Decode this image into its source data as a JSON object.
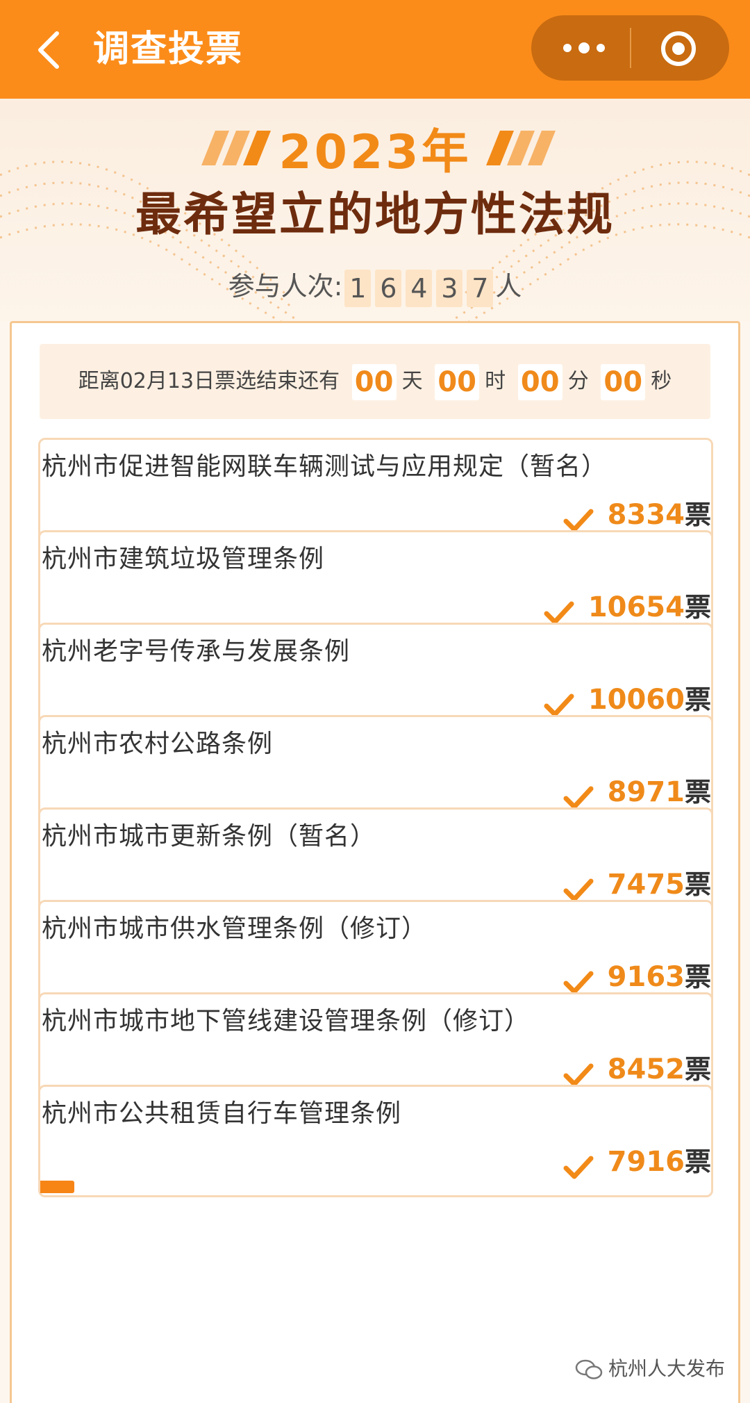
{
  "header": {
    "title": "调查投票"
  },
  "hero": {
    "year": "2023年",
    "headline": "最希望立的地方性法规",
    "participants_label": "参与人次:",
    "participants_digits": [
      "1",
      "6",
      "4",
      "3",
      "7"
    ],
    "participants_unit": "人"
  },
  "countdown": {
    "prefix": "距离02月13日票选结束还有",
    "days": "00",
    "days_unit": "天",
    "hours": "00",
    "hours_unit": "时",
    "minutes": "00",
    "minutes_unit": "分",
    "seconds": "00",
    "seconds_unit": "秒"
  },
  "vote_unit": "票",
  "items": [
    {
      "name": "杭州市促进智能网联车辆测试与应用规定（暂名）",
      "votes": "8334",
      "bar_fraction": 0.054
    },
    {
      "name": "杭州市建筑垃圾管理条例",
      "votes": "10654",
      "bar_fraction": 0.068
    },
    {
      "name": "杭州老字号传承与发展条例",
      "votes": "10060",
      "bar_fraction": 0.065
    },
    {
      "name": "杭州市农村公路条例",
      "votes": "8971",
      "bar_fraction": 0.058
    },
    {
      "name": "杭州市城市更新条例（暂名）",
      "votes": "7475",
      "bar_fraction": 0.048
    },
    {
      "name": "杭州市城市供水管理条例（修订）",
      "votes": "9163",
      "bar_fraction": 0.059
    },
    {
      "name": "杭州市城市地下管线建设管理条例（修订）",
      "votes": "8452",
      "bar_fraction": 0.055
    },
    {
      "name": "杭州市公共租赁自行车管理条例",
      "votes": "7916",
      "bar_fraction": 0.051
    }
  ],
  "watermark": "杭州人大发布",
  "colors": {
    "accent": "#fb8c1a",
    "vote_number": "#ef8a1a",
    "headline": "#6e2c0e"
  }
}
